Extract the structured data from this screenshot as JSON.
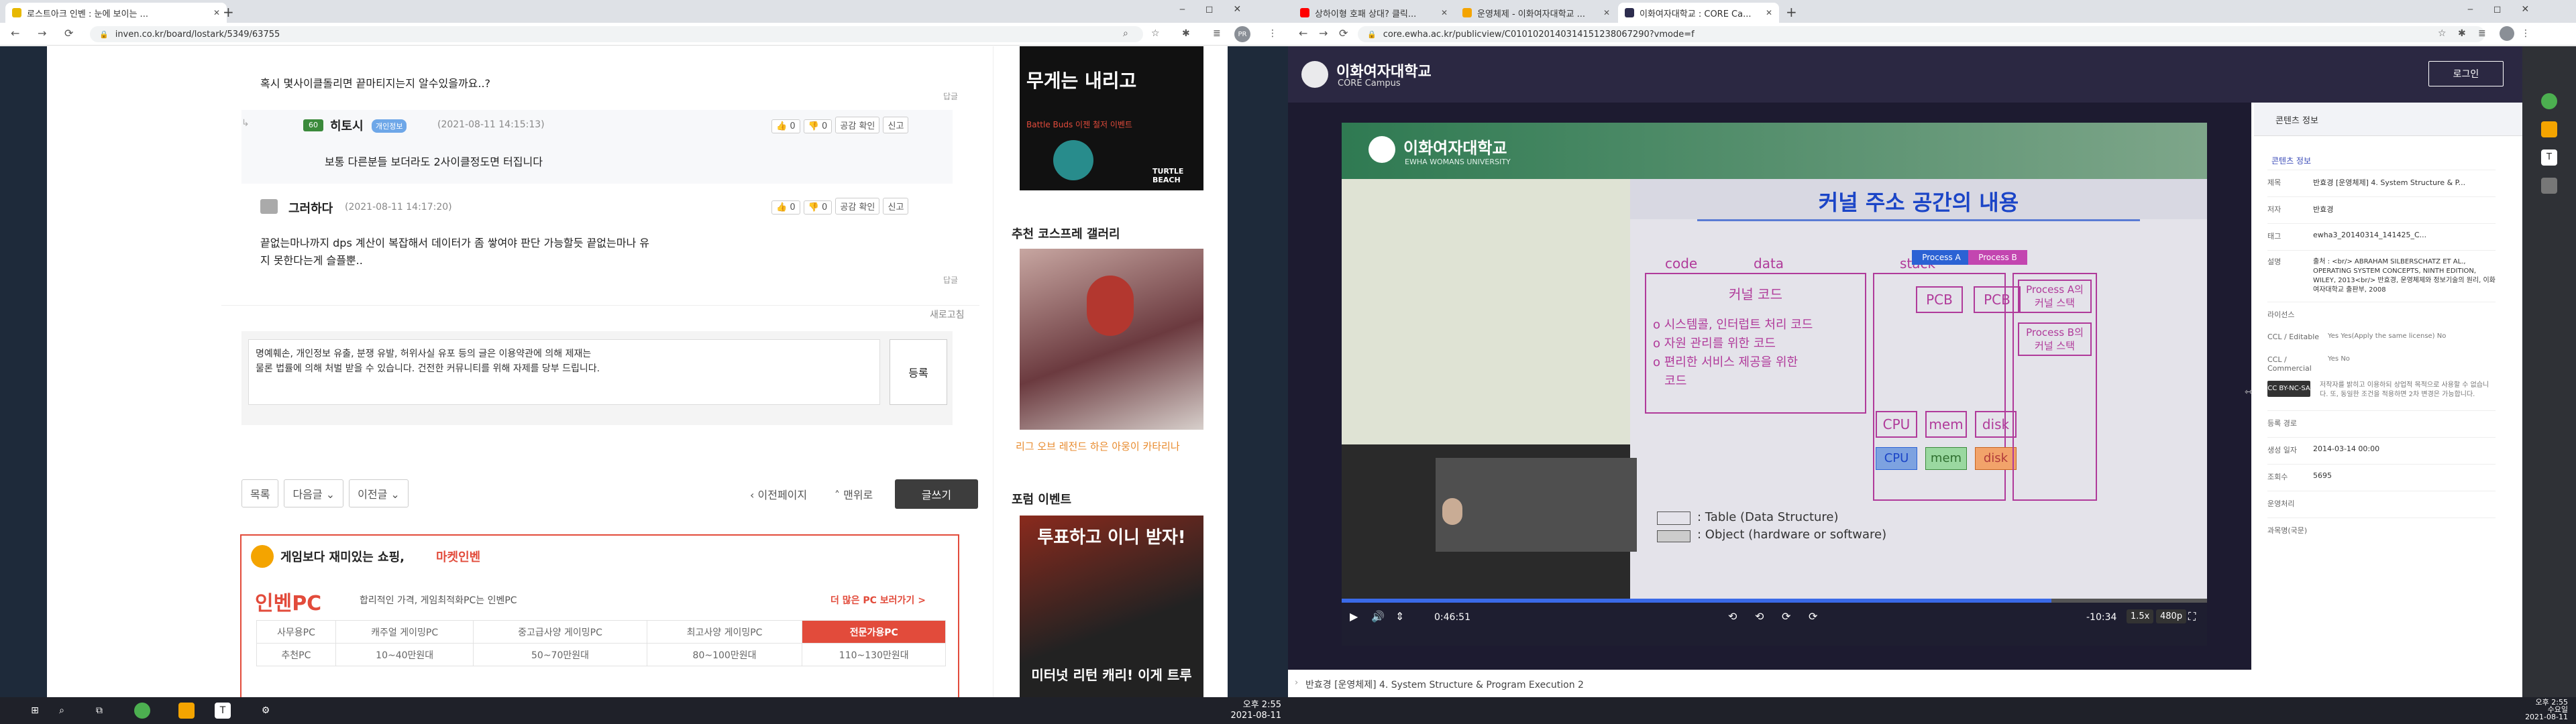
{
  "left_browser": {
    "tabs": [
      {
        "title": "로스트아크 인벤 : 눈에 보이는 ..."
      }
    ],
    "url": "inven.co.kr/board/lostark/5349/63755",
    "profile": "PR",
    "comments": {
      "c0_text": "혹시 몇사이클돌리면 끝마티지는지 알수있을까요..?",
      "reply_label": "답글",
      "reply_author": "히토시",
      "reply_level": "60",
      "reply_badge": "개인정보",
      "reply_date": "(2021-08-11 14:15:13)",
      "reply_text": "보통 다른분들 보더라도 2사이클정도면 터집니다",
      "up_label": "0",
      "down_label": "0",
      "empathy_label": "공감 확인",
      "report_label": "신고",
      "c2_author": "그러하다",
      "c2_date": "(2021-08-11 14:17:20)",
      "c2_text_line1": "끝없는마나까지 dps  계산이 복잡해서 데이터가 좀 쌓여야 판단 가능할듯   끝없는마나 유",
      "c2_text_line2": "지 못한다는게 슬플뿐..",
      "refresh_label": "새로고침",
      "input_text_line1": "명예훼손, 개인정보 유출, 분쟁 유발, 허위사실 유포 등의 글은 이용약관에 의해 제재는",
      "input_text_line2": "물론 법률에 의해 처벌 받을 수 있습니다. 건전한 커뮤니티를 위해 자제를 당부 드립니다.",
      "submit_label": "등록"
    },
    "postnav": {
      "list": "목록",
      "next": "다음글",
      "prev": "이전글",
      "prev_page": "이전페이지",
      "top": "맨위로",
      "write": "글쓰기"
    },
    "shop": {
      "headline_a": "게임보다 재미있는 쇼핑,",
      "headline_b": "마켓인벤",
      "logo": "인벤PC",
      "desc": "합리적인 가격, 게임최적화PC는 인벤PC",
      "more": "더 많은 PC 보러가기 >",
      "columns": [
        "사무용PC",
        "캐주얼 게이밍PC",
        "중고급사양 게이밍PC",
        "최고사양 게이밍PC",
        "전문가용PC"
      ],
      "rows": [
        [
          "추천PC",
          "10~40만원대",
          "50~70만원대",
          "80~100만원대",
          "110~130만원대"
        ]
      ]
    },
    "sidebar": {
      "ad_title": "무게는 내리고",
      "ad_sub": "Battle Buds 이젠 철저 이벤트",
      "ad_brand": "TURTLE BEACH",
      "cosplay_title": "추천 코스프레 갤러리",
      "cosplay_caption": "리그 오브 레전드 하은 아웅이 카타리나",
      "forum_title": "포럼 이벤트",
      "forum_banner_top": "투표하고 이니 받자!",
      "forum_banner_bottom": "미터넛 리턴 캐리! 이게 트루"
    }
  },
  "right_browser": {
    "tabs": [
      {
        "title": "상하이형 호패 상대? 클릭...",
        "color": "#ff0000"
      },
      {
        "title": "운영체제 - 이화여자대학교 ...",
        "color": "#f4a400"
      },
      {
        "title": "이화여자대학교 : CORE Ca...",
        "color": "#2d2d4e"
      }
    ],
    "url": "core.ewha.ac.kr/publicview/C0101020140314151238067290?vmode=f",
    "site": {
      "name": "이화여자대학교",
      "sub": "CORE Campus",
      "login": "로그인"
    },
    "video": {
      "slide_logo": "이화여자대학교",
      "slide_logo_sub": "EWHA WOMANS UNIVERSITY",
      "slide_title": "커널 주소 공간의 내용",
      "col_code": "code",
      "col_data": "data",
      "col_stack": "stack",
      "kernel_code": "커널 코드",
      "code_items": [
        "o 시스템콜, 인터럽트 처리 코드",
        "o 자원 관리를 위한 코드",
        "o 편리한 서비스 제공을 위한",
        "   코드"
      ],
      "process_a": "Process A",
      "process_b": "Process B",
      "pcb": "PCB",
      "stack_a": "Process A의\n커널 스택",
      "stack_b": "Process B의\n커널 스택",
      "hw": [
        "CPU",
        "mem",
        "disk"
      ],
      "legend_table": ":  Table  (Data Structure)",
      "legend_object": ":  Object (hardware or software)",
      "time": "0:46:51",
      "remaining": "-10:34",
      "speed": "1.5x",
      "quality": "480p",
      "progress": 0.82
    },
    "caption": "반효경 [운영체제] 4. System Structure & Program Execution 2",
    "info": {
      "header": "콘텐츠 정보",
      "section": "콘텐츠 정보",
      "rows": [
        {
          "k": "제목",
          "v": "반효경 [운영체제] 4. System Structure & P..."
        },
        {
          "k": "저자",
          "v": "반효경"
        },
        {
          "k": "태그",
          "v": "ewha3_20140314_141425_C..."
        },
        {
          "k": "설명",
          "v": "출처 : <br/> ABRAHAM SILBERSCHATZ ET AL., OPERATING SYSTEM CONCEPTS, NINTH EDITION, WILEY, 2013<br/> 반효경, 운영체제와 정보기술의 원리, 이화여자대학교 출판부, 2008"
        },
        {
          "k": "라이선스",
          "v": ""
        },
        {
          "k": "CCL / Editable",
          "v": "Yes   Yes(Apply the same license)   No"
        },
        {
          "k": "CCL / Commercial",
          "v": "Yes   No"
        },
        {
          "k": "",
          "v": "저작자를 밝히고 이용하되 상업적 목적으로 사용할 수 없습니다. 또, 동일한 조건을 적용하면 2차 변경은 가능합니다."
        },
        {
          "k": "등록 경로",
          "v": ""
        },
        {
          "k": "생성 일자",
          "v": "2014-03-14 00:00"
        },
        {
          "k": "조회수",
          "v": "5695"
        },
        {
          "k": "운영처리",
          "v": ""
        },
        {
          "k": "과목명(국문)",
          "v": ""
        }
      ]
    }
  },
  "taskbar": {
    "left_time": "오후 2:55",
    "left_date": "2021-08-11",
    "right_time": "오후 2:55",
    "right_day": "수요일",
    "right_date": "2021-08-11"
  }
}
